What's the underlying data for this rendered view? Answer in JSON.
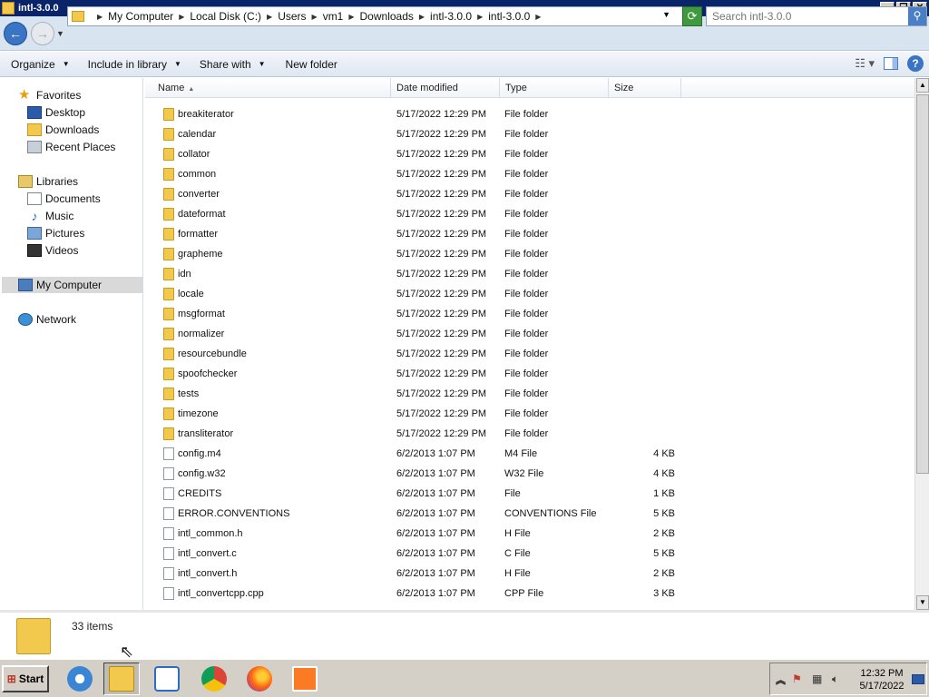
{
  "window": {
    "title": "intl-3.0.0"
  },
  "address": {
    "crumbs": [
      "My Computer",
      "Local Disk (C:)",
      "Users",
      "vm1",
      "Downloads",
      "intl-3.0.0",
      "intl-3.0.0"
    ],
    "search_placeholder": "Search intl-3.0.0"
  },
  "toolbar": {
    "organize": "Organize",
    "include_in_library": "Include in library",
    "share_with": "Share with",
    "new_folder": "New folder"
  },
  "sidebar": {
    "favorites": "Favorites",
    "desktop": "Desktop",
    "downloads": "Downloads",
    "recent_places": "Recent Places",
    "libraries": "Libraries",
    "documents": "Documents",
    "music": "Music",
    "pictures": "Pictures",
    "videos": "Videos",
    "my_computer": "My Computer",
    "network": "Network"
  },
  "columns": {
    "name": "Name",
    "date": "Date modified",
    "type": "Type",
    "size": "Size"
  },
  "files": [
    {
      "kind": "folder",
      "name": "breakiterator",
      "date": "5/17/2022 12:29 PM",
      "type": "File folder",
      "size": ""
    },
    {
      "kind": "folder",
      "name": "calendar",
      "date": "5/17/2022 12:29 PM",
      "type": "File folder",
      "size": ""
    },
    {
      "kind": "folder",
      "name": "collator",
      "date": "5/17/2022 12:29 PM",
      "type": "File folder",
      "size": ""
    },
    {
      "kind": "folder",
      "name": "common",
      "date": "5/17/2022 12:29 PM",
      "type": "File folder",
      "size": ""
    },
    {
      "kind": "folder",
      "name": "converter",
      "date": "5/17/2022 12:29 PM",
      "type": "File folder",
      "size": ""
    },
    {
      "kind": "folder",
      "name": "dateformat",
      "date": "5/17/2022 12:29 PM",
      "type": "File folder",
      "size": ""
    },
    {
      "kind": "folder",
      "name": "formatter",
      "date": "5/17/2022 12:29 PM",
      "type": "File folder",
      "size": ""
    },
    {
      "kind": "folder",
      "name": "grapheme",
      "date": "5/17/2022 12:29 PM",
      "type": "File folder",
      "size": ""
    },
    {
      "kind": "folder",
      "name": "idn",
      "date": "5/17/2022 12:29 PM",
      "type": "File folder",
      "size": ""
    },
    {
      "kind": "folder",
      "name": "locale",
      "date": "5/17/2022 12:29 PM",
      "type": "File folder",
      "size": ""
    },
    {
      "kind": "folder",
      "name": "msgformat",
      "date": "5/17/2022 12:29 PM",
      "type": "File folder",
      "size": ""
    },
    {
      "kind": "folder",
      "name": "normalizer",
      "date": "5/17/2022 12:29 PM",
      "type": "File folder",
      "size": ""
    },
    {
      "kind": "folder",
      "name": "resourcebundle",
      "date": "5/17/2022 12:29 PM",
      "type": "File folder",
      "size": ""
    },
    {
      "kind": "folder",
      "name": "spoofchecker",
      "date": "5/17/2022 12:29 PM",
      "type": "File folder",
      "size": ""
    },
    {
      "kind": "folder",
      "name": "tests",
      "date": "5/17/2022 12:29 PM",
      "type": "File folder",
      "size": ""
    },
    {
      "kind": "folder",
      "name": "timezone",
      "date": "5/17/2022 12:29 PM",
      "type": "File folder",
      "size": ""
    },
    {
      "kind": "folder",
      "name": "transliterator",
      "date": "5/17/2022 12:29 PM",
      "type": "File folder",
      "size": ""
    },
    {
      "kind": "file",
      "name": "config.m4",
      "date": "6/2/2013 1:07 PM",
      "type": "M4 File",
      "size": "4 KB"
    },
    {
      "kind": "file",
      "name": "config.w32",
      "date": "6/2/2013 1:07 PM",
      "type": "W32 File",
      "size": "4 KB"
    },
    {
      "kind": "file",
      "name": "CREDITS",
      "date": "6/2/2013 1:07 PM",
      "type": "File",
      "size": "1 KB"
    },
    {
      "kind": "file",
      "name": "ERROR.CONVENTIONS",
      "date": "6/2/2013 1:07 PM",
      "type": "CONVENTIONS File",
      "size": "5 KB"
    },
    {
      "kind": "file",
      "name": "intl_common.h",
      "date": "6/2/2013 1:07 PM",
      "type": "H File",
      "size": "2 KB"
    },
    {
      "kind": "file",
      "name": "intl_convert.c",
      "date": "6/2/2013 1:07 PM",
      "type": "C File",
      "size": "5 KB"
    },
    {
      "kind": "file",
      "name": "intl_convert.h",
      "date": "6/2/2013 1:07 PM",
      "type": "H File",
      "size": "2 KB"
    },
    {
      "kind": "file",
      "name": "intl_convertcpp.cpp",
      "date": "6/2/2013 1:07 PM",
      "type": "CPP File",
      "size": "3 KB"
    }
  ],
  "details": {
    "item_count": "33 items"
  },
  "taskbar": {
    "start": "Start",
    "time": "12:32 PM",
    "date": "5/17/2022"
  }
}
